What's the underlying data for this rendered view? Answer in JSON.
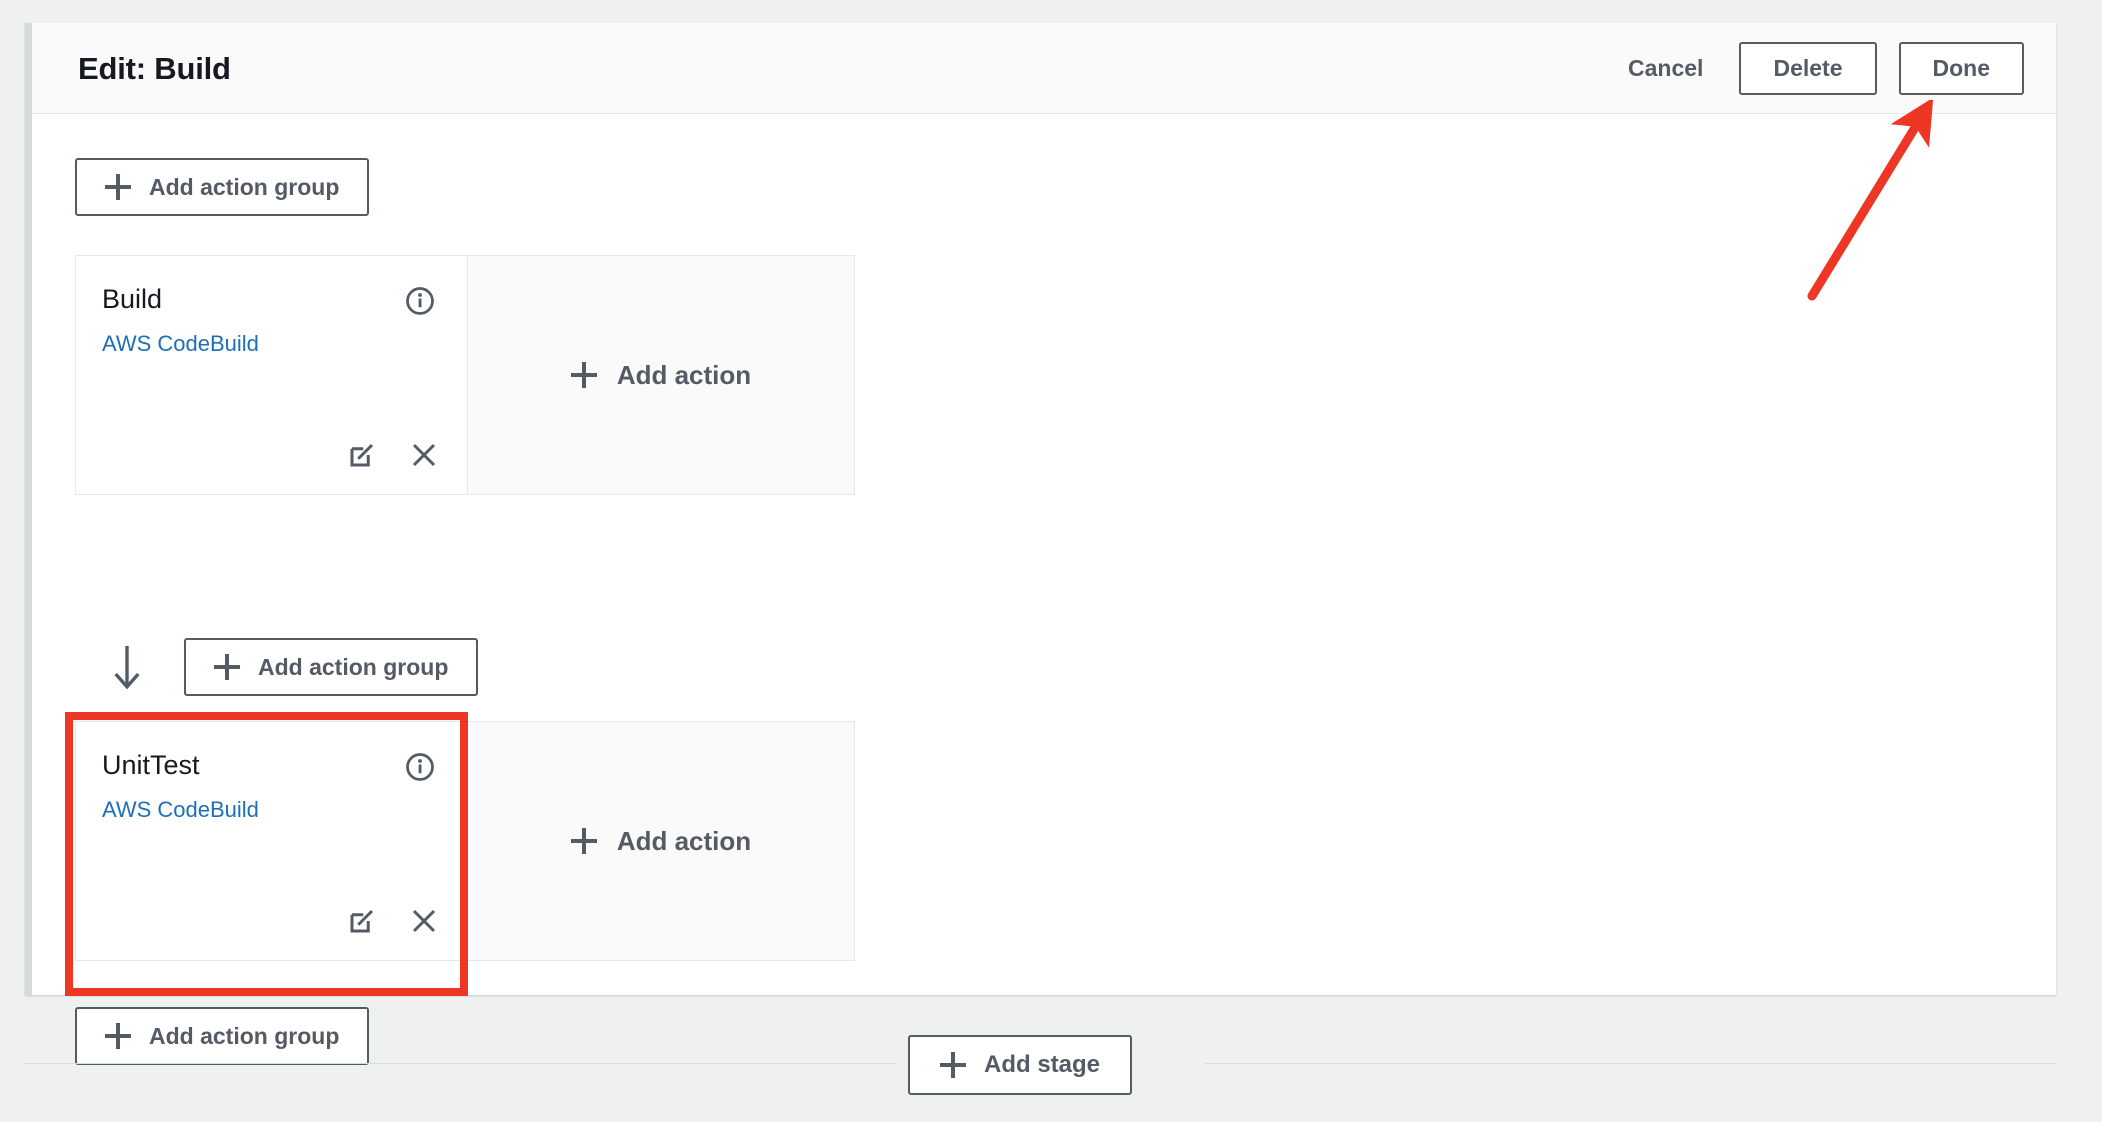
{
  "header": {
    "title": "Edit: Build",
    "cancel_label": "Cancel",
    "delete_label": "Delete",
    "done_label": "Done"
  },
  "colors": {
    "accent_link": "#1f6fb8",
    "annotation_red": "#ee3624",
    "button_border": "#545b64",
    "panel_background": "#ffffff",
    "page_background": "#eff1f1"
  },
  "body": {
    "add_action_group_top": "Add action group",
    "add_action_group_middle": "Add action group",
    "add_action_group_bottom": "Add action group",
    "arrow_icon": "arrow-down-icon"
  },
  "action_groups": [
    {
      "name": "Build",
      "provider": "AWS CodeBuild",
      "info_icon": "info-circle-icon",
      "edit_icon": "edit-pencil-icon",
      "remove_icon": "close-x-icon",
      "add_action_label": "Add action",
      "highlighted": false
    },
    {
      "name": "UnitTest",
      "provider": "AWS CodeBuild",
      "info_icon": "info-circle-icon",
      "edit_icon": "edit-pencil-icon",
      "remove_icon": "close-x-icon",
      "add_action_label": "Add action",
      "highlighted": true
    }
  ],
  "footer": {
    "add_stage_label": "Add stage"
  },
  "annotations": {
    "arrow_points_to": "Done",
    "highlight_target": "UnitTest"
  }
}
